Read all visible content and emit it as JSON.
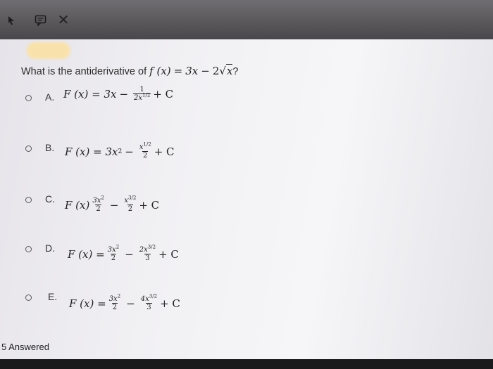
{
  "toolbar": {
    "pointer_icon": "cursor-arrow-icon",
    "note_icon": "note-icon",
    "close_label": "✕"
  },
  "question": {
    "prefix": "What is the antiderivative of ",
    "fx": "f",
    "paren_x": "(x)",
    "equals": "=",
    "term1": "3x",
    "minus": "−",
    "coef": "2",
    "sqrt_symbol": "√",
    "sqrt_arg": "x",
    "suffix": "?"
  },
  "options": [
    {
      "letter": "A.",
      "lhs": "F (x) = 3x",
      "minus": "−",
      "num": "1",
      "den_base": "2x",
      "den_exp_num": "1",
      "den_exp_den": "2",
      "tail": "+ C"
    },
    {
      "letter": "B.",
      "lhs": "F (x) = 3x",
      "lhs_exp": "2",
      "minus": "−",
      "num_base": "x",
      "num_exp_num": "1",
      "num_exp_den": "2",
      "den": "2",
      "tail": "+ C"
    },
    {
      "letter": "C.",
      "lhs": "F (x)",
      "t1_num": "3x",
      "t1_exp": "2",
      "t1_den": "2",
      "minus": "−",
      "num_base": "x",
      "num_exp_num": "3",
      "num_exp_den": "2",
      "den": "2",
      "tail": "+ C"
    },
    {
      "letter": "D.",
      "lhs": "F (x) =",
      "t1_num": "3x",
      "t1_exp": "2",
      "t1_den": "2",
      "minus": "−",
      "num_base": "2x",
      "num_exp_num": "3",
      "num_exp_den": "2",
      "den": "3",
      "tail": "+ C"
    },
    {
      "letter": "E.",
      "lhs": "F (x) =",
      "t1_num": "3x",
      "t1_exp": "2",
      "t1_den": "2",
      "minus": "−",
      "num_base": "4x",
      "num_exp_num": "3",
      "num_exp_den": "2",
      "den": "3",
      "tail": "+ C"
    }
  ],
  "footer": {
    "answered": "5 Answered"
  }
}
